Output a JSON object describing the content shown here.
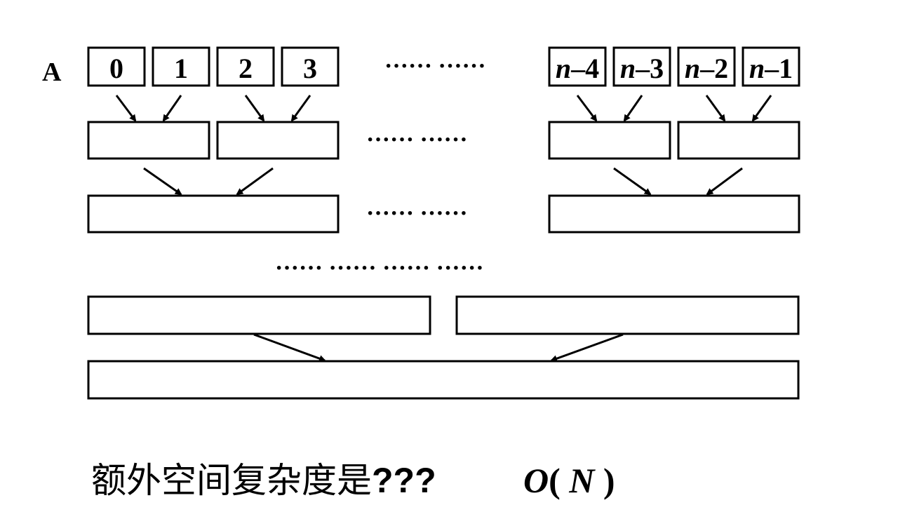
{
  "array_label": "A",
  "cells_left": [
    "0",
    "1",
    "2",
    "3"
  ],
  "cells_right": [
    {
      "var": "n",
      "op": "–",
      "num": "4"
    },
    {
      "var": "n",
      "op": "–",
      "num": "3"
    },
    {
      "var": "n",
      "op": "–",
      "num": "2"
    },
    {
      "var": "n",
      "op": "–",
      "num": "1"
    }
  ],
  "ellipsis_row1": "······ ······",
  "ellipsis_row2": "······ ······",
  "ellipsis_row3": "······ ······",
  "ellipsis_middle": "······ ······ ······ ······",
  "question": {
    "text": "额外空间复杂度是",
    "marks": "???"
  },
  "answer": {
    "big_o": "O",
    "open": "( ",
    "var": "N",
    "close": " )"
  }
}
